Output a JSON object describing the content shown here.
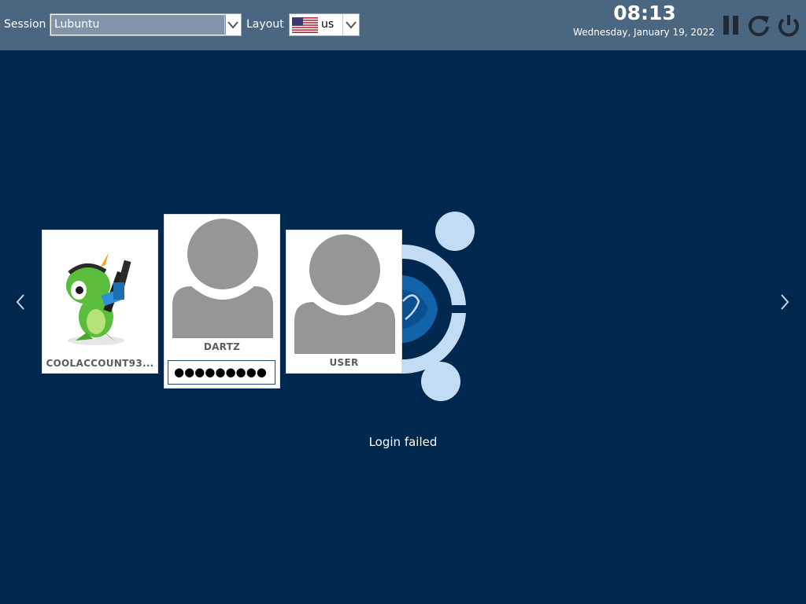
{
  "topbar": {
    "session_label": "Session",
    "session_value": "Lubuntu",
    "layout_label": "Layout",
    "layout_value": "us",
    "time": "08:13",
    "date": "Wednesday, January 19, 2022"
  },
  "users": [
    {
      "name": "COOLACCOUNT93..."
    },
    {
      "name": "DARTZ",
      "password_mask": "●●●●●●●●●"
    },
    {
      "name": "USER"
    }
  ],
  "status": {
    "message": "Login failed"
  },
  "icons": {
    "suspend": "pause-icon",
    "restart": "restart-icon",
    "shutdown": "power-icon",
    "prev": "chevron-left-icon",
    "next": "chevron-right-icon",
    "flag": "us-flag-icon"
  },
  "colors": {
    "background": "#00284f",
    "topbar": "#4a6681",
    "logo": "#c3dcf5"
  }
}
